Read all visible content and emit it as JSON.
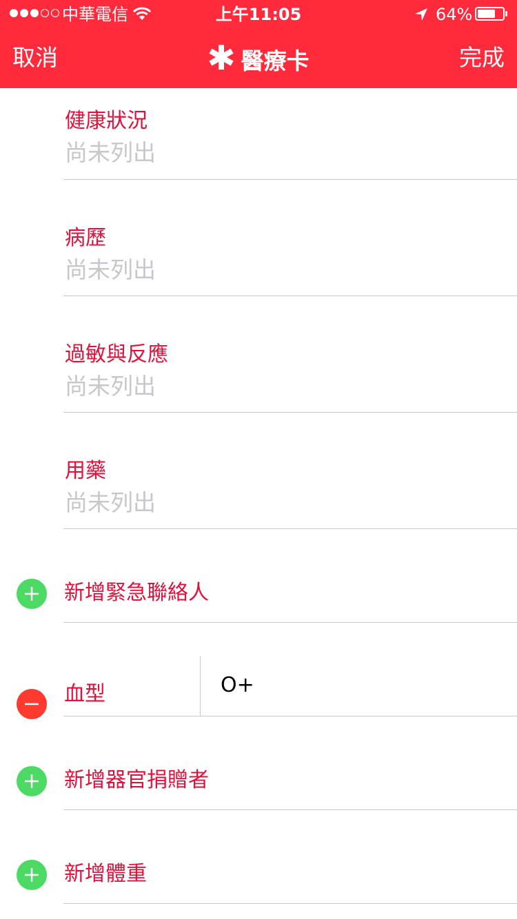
{
  "status_bar": {
    "carrier": "中華電信",
    "time": "上午11:05",
    "battery": "64%",
    "battery_level": 0.64,
    "signal_bars_filled": 3,
    "signal_bars_total": 5
  },
  "nav": {
    "cancel": "取消",
    "title": "醫療卡",
    "done": "完成"
  },
  "sections": [
    {
      "label": "健康狀況",
      "value": "尚未列出"
    },
    {
      "label": "病歷",
      "value": "尚未列出"
    },
    {
      "label": "過敏與反應",
      "value": "尚未列出"
    },
    {
      "label": "用藥",
      "value": "尚未列出"
    }
  ],
  "rows": {
    "add_emergency_contact": "新增緊急聯絡人",
    "blood_type_label": "血型",
    "blood_type_value": "O+",
    "add_organ_donor": "新增器官捐贈者",
    "add_weight": "新增體重"
  },
  "colors": {
    "accent": "#ff2a3b",
    "label_red": "#e0123b",
    "placeholder_gray": "#c7c7cc",
    "add_green": "#4cd964",
    "remove_red": "#ff3b30"
  }
}
